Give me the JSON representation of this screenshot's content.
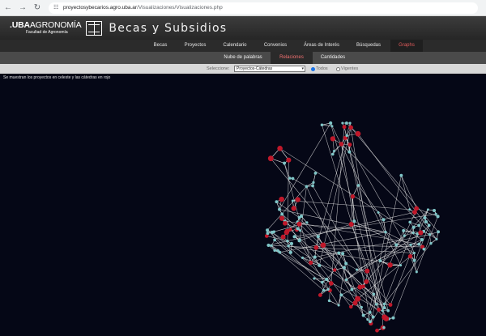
{
  "browser": {
    "url_host": "proyectosybecarios.agro.uba.ar",
    "url_path": "/Visualizaciones/Visualizaciones.php"
  },
  "header": {
    "logo_uba": ".UBA",
    "logo_agro": "AGRONOMÍA",
    "logo_sub": "Facultad de Agronomía",
    "title": "Becas y Subsidios"
  },
  "main_nav": {
    "items": [
      "Becas",
      "Proyectos",
      "Calendario",
      "Convenios",
      "Áreas de Interés",
      "Búsquedas",
      "Graphs"
    ],
    "active": "Graphs"
  },
  "sub_nav": {
    "items": [
      "Nube de palabras",
      "Relaciones",
      "Cantidades"
    ],
    "active": "Relaciones"
  },
  "filter": {
    "label": "Seleccione:",
    "selected": "Proyectos-Cátedras",
    "radio_all": "Todos",
    "radio_current": "Vigentes",
    "radio_selected": "Todos"
  },
  "caption": "Se muestran los proyectos en celeste y las cátedras en rojo",
  "colors": {
    "project_node": "#7fc6c8",
    "chair_node": "#c0182a",
    "edge": "#e8e8e8",
    "background": "#050716",
    "active_tab": "#e05a5a"
  },
  "icons": {
    "back": "arrow-left-icon",
    "forward": "arrow-right-icon",
    "reload": "reload-icon",
    "site_settings": "tune-icon",
    "logo": "book-icon"
  }
}
